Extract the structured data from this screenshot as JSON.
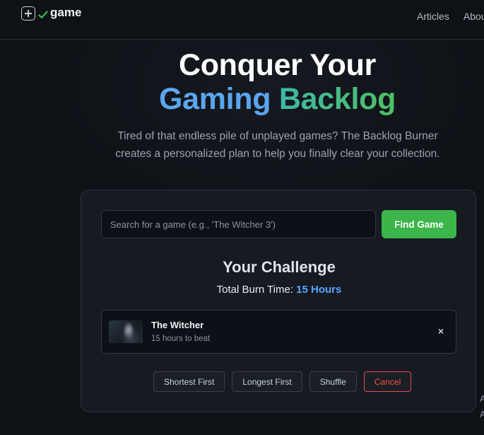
{
  "nav": {
    "brand": "game",
    "links": [
      "Articles",
      "Abou"
    ]
  },
  "hero": {
    "title_line1": "Conquer Your",
    "title_word1": "Gaming",
    "title_word2": "Backlog",
    "subtitle": "Tired of that endless pile of unplayed games? The Backlog Burner creates a personalized plan to help you finally clear your collection."
  },
  "search": {
    "placeholder": "Search for a game (e.g., 'The Witcher 3')",
    "value": "",
    "button_label": "Find Game"
  },
  "challenge": {
    "title": "Your Challenge",
    "burn_label": "Total Burn Time: ",
    "burn_value": "15 Hours",
    "games": [
      {
        "name": "The Witcher",
        "time": "15 hours to beat"
      }
    ],
    "remove_symbol": "×"
  },
  "actions": {
    "shortest": "Shortest First",
    "longest": "Longest First",
    "shuffle": "Shuffle",
    "cancel": "Cancel"
  },
  "edge_text": [
    "A",
    "A"
  ],
  "colors": {
    "accent_green": "#3cb54a",
    "accent_blue": "#58a6ff",
    "cancel_red": "#f85149"
  },
  "icons": [
    "plus-square-icon",
    "check-icon",
    "close-icon"
  ]
}
